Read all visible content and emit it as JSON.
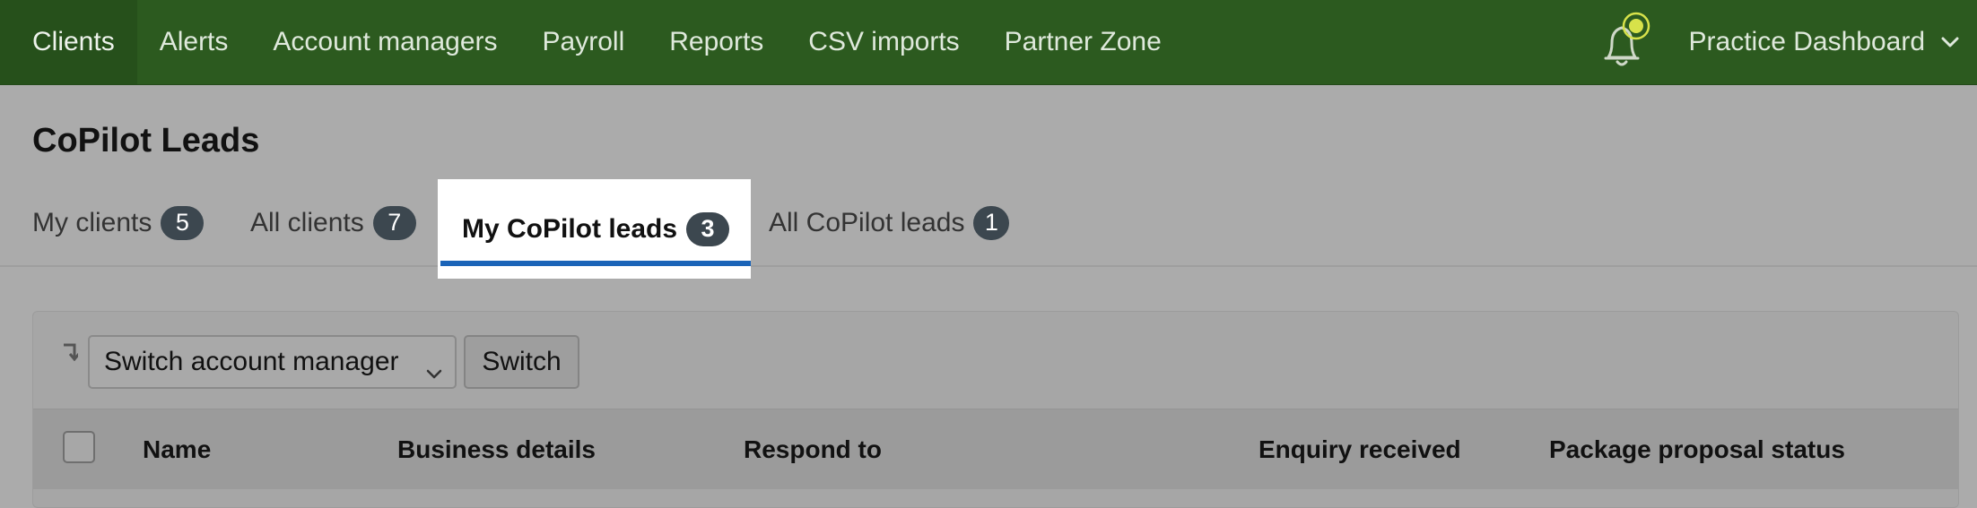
{
  "nav": {
    "items": [
      {
        "label": "Clients",
        "active": true
      },
      {
        "label": "Alerts"
      },
      {
        "label": "Account managers"
      },
      {
        "label": "Payroll"
      },
      {
        "label": "Reports"
      },
      {
        "label": "CSV imports"
      },
      {
        "label": "Partner Zone"
      }
    ],
    "bell_icon": "bell-icon",
    "practice_label": "Practice Dashboard"
  },
  "page": {
    "title": "CoPilot Leads"
  },
  "tabs": [
    {
      "label": "My clients",
      "count": "5"
    },
    {
      "label": "All clients",
      "count": "7"
    },
    {
      "label": "My CoPilot leads",
      "count": "3",
      "active": true
    },
    {
      "label": "All CoPilot leads",
      "count": "1"
    }
  ],
  "toolbar": {
    "select_value": "Switch account manager",
    "switch_label": "Switch"
  },
  "table": {
    "headers": [
      "Name",
      "Business details",
      "Respond to",
      "Enquiry received",
      "Package proposal status"
    ]
  },
  "colors": {
    "nav_bg": "#2c5a1f",
    "active_tab_underline": "#1b64b8",
    "badge_bg": "#3c474f",
    "bell_accent": "#d7e24a"
  }
}
